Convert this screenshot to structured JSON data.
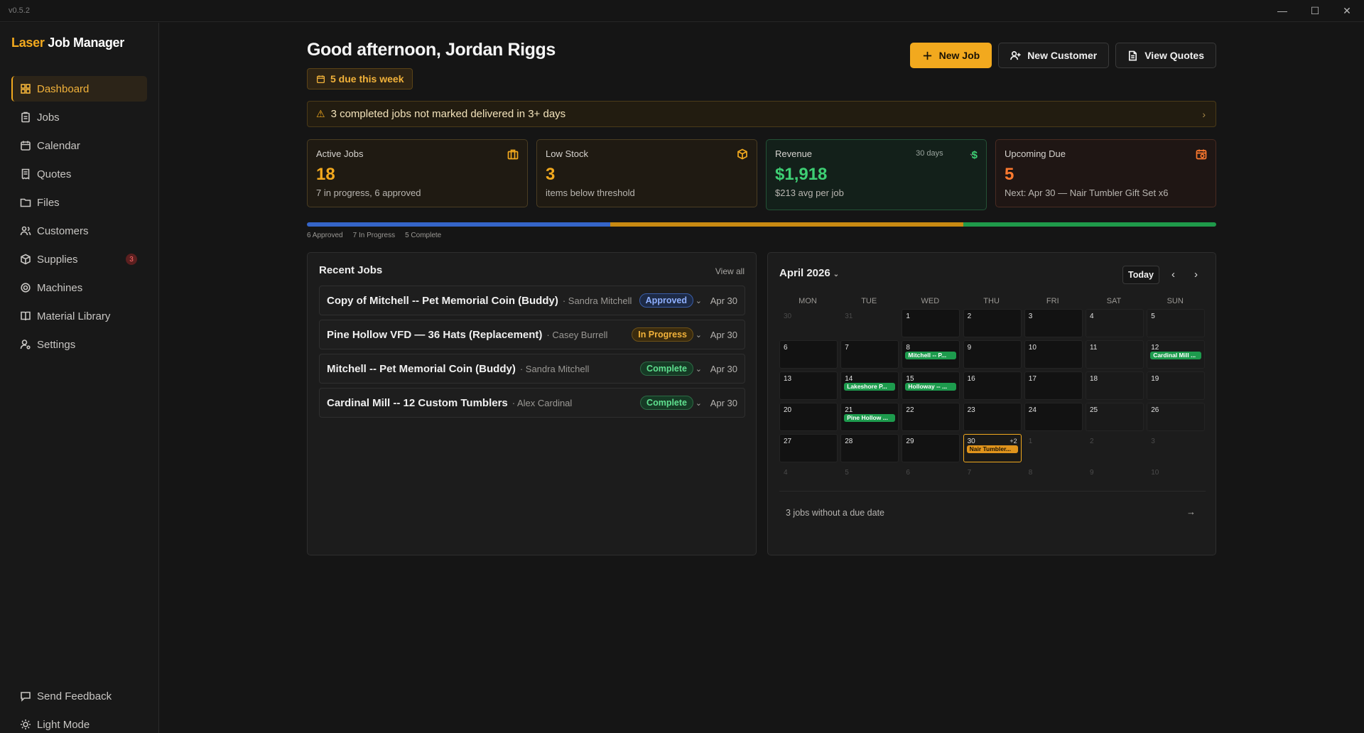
{
  "app": {
    "version": "v0.5.2",
    "brand_accent": "Laser",
    "brand_rest": "Job Manager"
  },
  "window_controls": {
    "minimize": "—",
    "maximize": "☐",
    "close": "✕"
  },
  "sidebar": {
    "items": [
      {
        "label": "Dashboard",
        "icon": "grid-icon",
        "active": true
      },
      {
        "label": "Jobs",
        "icon": "clipboard-icon"
      },
      {
        "label": "Calendar",
        "icon": "calendar-icon"
      },
      {
        "label": "Quotes",
        "icon": "receipt-icon"
      },
      {
        "label": "Files",
        "icon": "folder-icon"
      },
      {
        "label": "Customers",
        "icon": "users-icon"
      },
      {
        "label": "Supplies",
        "icon": "box-icon",
        "badge": "3"
      },
      {
        "label": "Machines",
        "icon": "cog-icon"
      },
      {
        "label": "Material Library",
        "icon": "book-icon"
      },
      {
        "label": "Settings",
        "icon": "user-cog-icon"
      }
    ],
    "bottom": {
      "feedback": "Send Feedback",
      "theme": "Light Mode"
    }
  },
  "header": {
    "greeting": "Good afternoon, Jordan Riggs",
    "due_pill": "5 due this week",
    "actions": {
      "new_job": "New Job",
      "new_customer": "New Customer",
      "view_quotes": "View Quotes"
    }
  },
  "alert": {
    "text": "3 completed jobs not marked delivered in 3+ days"
  },
  "stats": {
    "active_jobs": {
      "label": "Active Jobs",
      "value": "18",
      "sub": "7 in progress, 6 approved"
    },
    "low_stock": {
      "label": "Low Stock",
      "value": "3",
      "sub": "items below threshold"
    },
    "revenue": {
      "label": "Revenue",
      "period": "30 days",
      "value": "$1,918",
      "sub": "$213 avg per job"
    },
    "upcoming_due": {
      "label": "Upcoming Due",
      "value": "5",
      "sub": "Next: Apr 30 — Nair Tumbler Gift Set x6"
    }
  },
  "status_bar": {
    "segments": [
      {
        "label": "6 Approved",
        "count": 6,
        "color": "#3565c8"
      },
      {
        "label": "7 In Progress",
        "count": 7,
        "color": "#c98a12"
      },
      {
        "label": "5 Complete",
        "count": 5,
        "color": "#1f9a4a"
      }
    ]
  },
  "recent_jobs": {
    "title": "Recent Jobs",
    "view_all": "View all",
    "rows": [
      {
        "name": "Copy of Mitchell -- Pet Memorial Coin (Buddy)",
        "customer": "· Sandra Mitchell",
        "status": "Approved",
        "date": "Apr 30"
      },
      {
        "name": "Pine Hollow VFD — 36 Hats (Replacement)",
        "customer": "· Casey Burrell",
        "status": "In Progress",
        "date": "Apr 30"
      },
      {
        "name": "Mitchell -- Pet Memorial Coin (Buddy)",
        "customer": "· Sandra Mitchell",
        "status": "Complete",
        "date": "Apr 30"
      },
      {
        "name": "Cardinal Mill -- 12 Custom Tumblers",
        "customer": "· Alex Cardinal",
        "status": "Complete",
        "date": "Apr 30"
      }
    ]
  },
  "calendar": {
    "month": "April 2026",
    "today_label": "Today",
    "days_of_week": [
      "MON",
      "TUE",
      "WED",
      "THU",
      "FRI",
      "SAT",
      "SUN"
    ],
    "weeks": [
      [
        {
          "d": "30",
          "o": true
        },
        {
          "d": "31",
          "o": true
        },
        {
          "d": "1"
        },
        {
          "d": "2"
        },
        {
          "d": "3"
        },
        {
          "d": "4"
        },
        {
          "d": "5"
        }
      ],
      [
        {
          "d": "6"
        },
        {
          "d": "7"
        },
        {
          "d": "8",
          "ev": "Mitchell -- P..."
        },
        {
          "d": "9"
        },
        {
          "d": "10"
        },
        {
          "d": "11"
        },
        {
          "d": "12",
          "ev": "Cardinal Mill ..."
        }
      ],
      [
        {
          "d": "13"
        },
        {
          "d": "14",
          "ev": "Lakeshore P..."
        },
        {
          "d": "15",
          "ev": "Holloway -- ..."
        },
        {
          "d": "16"
        },
        {
          "d": "17"
        },
        {
          "d": "18"
        },
        {
          "d": "19"
        }
      ],
      [
        {
          "d": "20"
        },
        {
          "d": "21",
          "ev": "Pine Hollow ..."
        },
        {
          "d": "22"
        },
        {
          "d": "23"
        },
        {
          "d": "24"
        },
        {
          "d": "25"
        },
        {
          "d": "26"
        }
      ],
      [
        {
          "d": "27"
        },
        {
          "d": "28"
        },
        {
          "d": "29"
        },
        {
          "d": "30",
          "today": true,
          "plus": "+2",
          "ev": "Nair Tumbler...",
          "evColor": "orange"
        },
        {
          "d": "1",
          "o": true
        },
        {
          "d": "2",
          "o": true
        },
        {
          "d": "3",
          "o": true
        }
      ],
      [
        {
          "d": "4",
          "o": true
        },
        {
          "d": "5",
          "o": true
        },
        {
          "d": "6",
          "o": true
        },
        {
          "d": "7",
          "o": true
        },
        {
          "d": "8",
          "o": true
        },
        {
          "d": "9",
          "o": true
        },
        {
          "d": "10",
          "o": true
        }
      ]
    ],
    "footer": "3 jobs without a due date",
    "footer_arrow": "→"
  },
  "colors": {
    "accent": "#f2a91e",
    "background": "#151515",
    "success": "#3ecf74",
    "danger": "#ff7a2f"
  }
}
